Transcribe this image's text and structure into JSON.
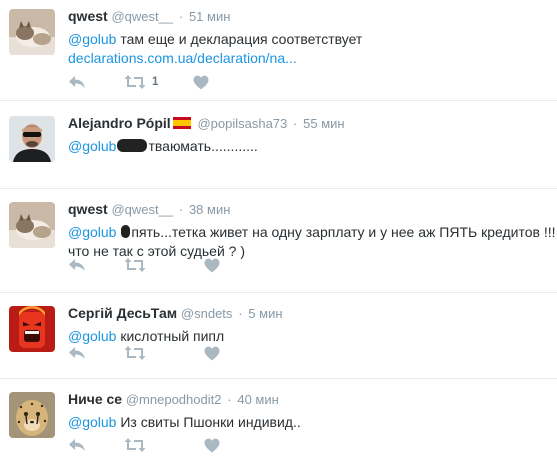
{
  "tweets": [
    {
      "name": "qwest",
      "handle": "@qwest__",
      "sep": "·",
      "time": "51 мин",
      "mention": "@golub",
      "text_line1": " там еще и декларация соответствует",
      "link": "declarations.com.ua/declaration/na...",
      "retweet_count": "1",
      "avatar": "cat-photo"
    },
    {
      "name": "Alejandro Pópil",
      "handle": "@popilsasha73",
      "sep": "·",
      "time": "55 мин",
      "mention": "@golub",
      "text_line1": "тваюмать............",
      "avatar": "man-photo"
    },
    {
      "name": "qwest",
      "handle": "@qwest__",
      "sep": "·",
      "time": "38 мин",
      "mention": "@golub",
      "text_line1": "пять...тетка живет на одну зарплату и у нее аж ПЯТЬ кредитов !!!",
      "text_line2": "что не так с этой судьей ? )",
      "avatar": "cat-photo"
    },
    {
      "name": "Сергій ДесьТам",
      "handle": "@sndets",
      "sep": "·",
      "time": "5 мин",
      "mention": "@golub",
      "text_line1": " кислотный пипл",
      "avatar": "anger-character"
    },
    {
      "name": "Ниче се",
      "handle": "@mnepodhodit2",
      "sep": "·",
      "time": "40 мин",
      "mention": "@golub",
      "text_line1": " Из свиты Пшонки индивид..",
      "avatar": "cheetah-photo"
    }
  ],
  "icons": {
    "reply": "reply-icon",
    "retweet": "retweet-icon",
    "like": "heart-icon"
  },
  "colors": {
    "link": "#1b95e0",
    "muted": "#8899a6",
    "icon": "#aab8c2",
    "text": "#292f33"
  }
}
